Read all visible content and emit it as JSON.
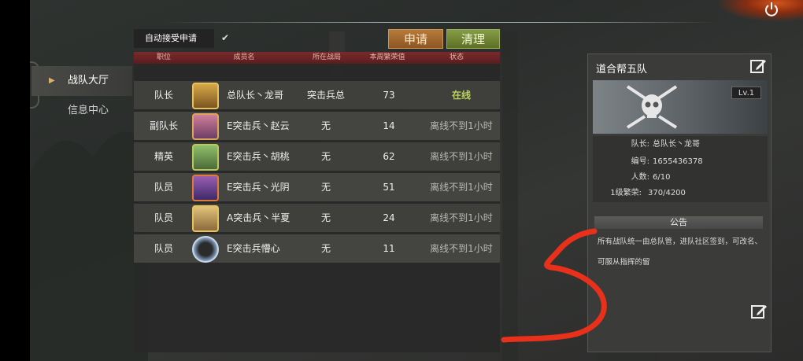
{
  "nav": {
    "items": [
      {
        "label": "战队大厅",
        "active": true
      },
      {
        "label": "信息中心",
        "active": false
      }
    ]
  },
  "toolbar": {
    "auto_accept_label": "自动接受申请",
    "auto_accept_checked": true,
    "apply_label": "申请",
    "clear_label": "清理"
  },
  "table": {
    "headers": [
      "职位",
      "成员名",
      "所在战局",
      "本周繁荣值",
      "状态"
    ],
    "rows": [
      {
        "position": "队长",
        "name": "总队长丶龙哥",
        "zone": "突击兵总",
        "honor": "73",
        "status": "在线",
        "online": true
      },
      {
        "position": "副队长",
        "name": "E突击兵丶赵云",
        "zone": "无",
        "honor": "14",
        "status": "离线不到1小时",
        "online": false
      },
      {
        "position": "精英",
        "name": "E突击兵丶胡桃",
        "zone": "无",
        "honor": "62",
        "status": "离线不到1小时",
        "online": false
      },
      {
        "position": "队员",
        "name": "E突击兵丶光阴",
        "zone": "无",
        "honor": "51",
        "status": "离线不到1小时",
        "online": false
      },
      {
        "position": "队员",
        "name": "A突击兵丶半夏",
        "zone": "无",
        "honor": "24",
        "status": "离线不到1小时",
        "online": false
      },
      {
        "position": "队员",
        "name": "E突击兵懵心",
        "zone": "无",
        "honor": "11",
        "status": "离线不到1小时",
        "online": false
      }
    ]
  },
  "team": {
    "name": "道合帮五队",
    "level": "Lv.1",
    "leader_label": "队长:",
    "leader": "总队长丶龙哥",
    "id_label": "编号:",
    "id": "1655436378",
    "count_label": "人数:",
    "count": "6/10",
    "prosperity_label": "1级繁荣:",
    "prosperity": "370/4200",
    "notice_title": "公告",
    "notice_text": "所有战队统一由总队管，进队社区签到，可改名、可服从指挥的留"
  },
  "colors": {
    "header_red": "#6e2427",
    "online_green": "#b8d25a",
    "apply_orange": "#a86b33",
    "clear_green": "#728a35",
    "scribble_red": "#e8301a"
  }
}
